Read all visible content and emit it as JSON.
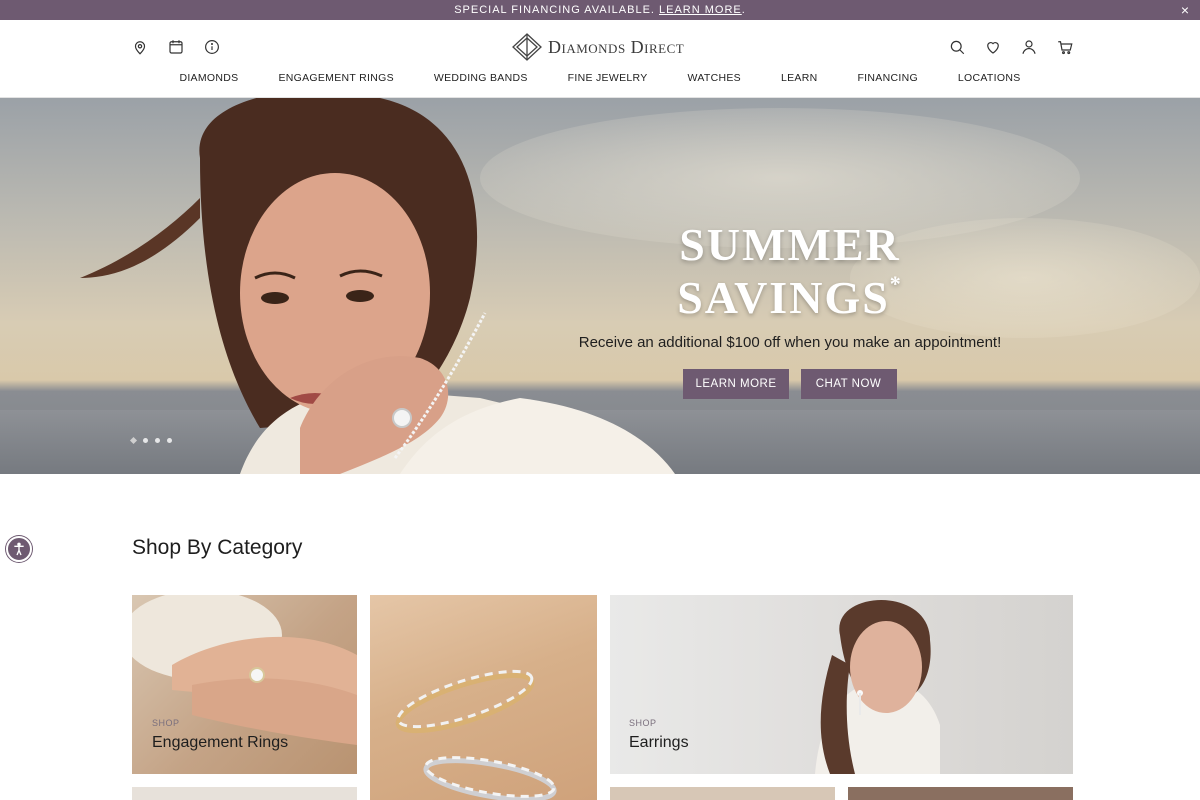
{
  "promo": {
    "text": "SPECIAL FINANCING AVAILABLE.",
    "link": "LEARN MORE",
    "period": ".",
    "close": "×"
  },
  "header": {
    "logo_text": "Diamonds Direct",
    "utility_left": [
      "location-pin-icon",
      "calendar-icon",
      "info-icon"
    ],
    "utility_right": [
      "search-icon",
      "heart-icon",
      "user-icon",
      "cart-icon"
    ]
  },
  "nav": {
    "items": [
      "DIAMONDS",
      "ENGAGEMENT RINGS",
      "WEDDING BANDS",
      "FINE JEWELRY",
      "WATCHES",
      "LEARN",
      "FINANCING",
      "LOCATIONS"
    ]
  },
  "hero": {
    "title": "SUMMER SAVINGS",
    "title_mark": "*",
    "subtitle": "Receive an additional $100 off when you make an appointment!",
    "buttons": [
      "LEARN MORE",
      "CHAT NOW"
    ],
    "slides_count": 4,
    "active_slide": 1
  },
  "categories": {
    "title": "Shop By Category",
    "items": [
      {
        "prefix": "SHOP",
        "label": "Engagement Rings"
      },
      {
        "prefix": "",
        "label": ""
      },
      {
        "prefix": "SHOP",
        "label": "Earrings"
      }
    ]
  },
  "colors": {
    "brand": "#6e5a71",
    "text": "#222222"
  }
}
